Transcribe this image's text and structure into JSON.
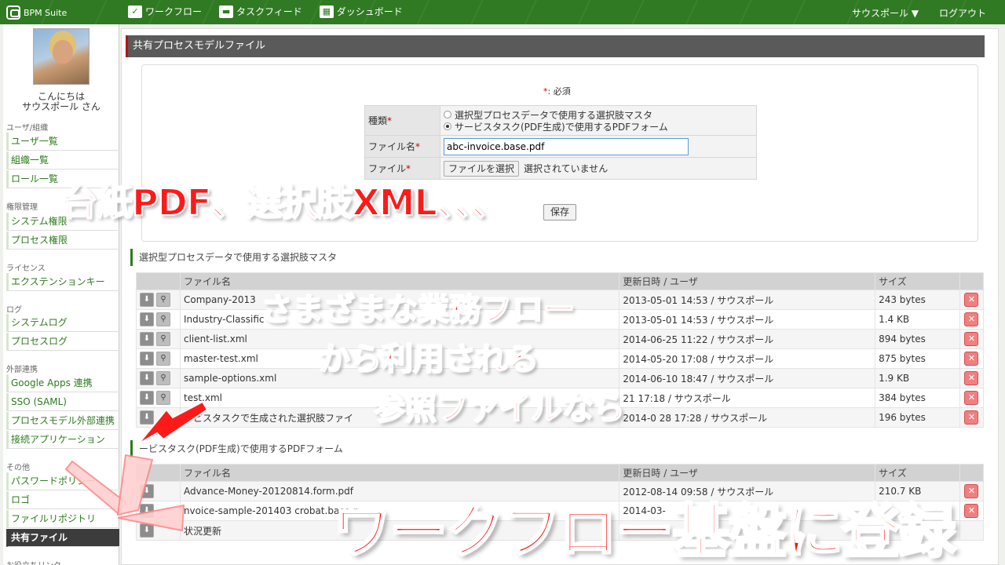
{
  "header": {
    "logo": "BPM Suite",
    "nav": [
      {
        "label": "ワークフロー"
      },
      {
        "label": "タスクフィード"
      },
      {
        "label": "ダッシュボード"
      }
    ],
    "user_menu": "サウスポール ▼",
    "logout": "ログアウト"
  },
  "sidebar": {
    "greeting_line1": "こんにちは",
    "greeting_line2": "サウスポール さん",
    "sections": [
      {
        "title": "ユーザ/組織",
        "items": [
          "ユーザ一覧",
          "組織一覧",
          "ロール一覧"
        ]
      },
      {
        "title": "権限管理",
        "items": [
          "システム権限",
          "プロセス権限"
        ]
      },
      {
        "title": "ライセンス",
        "items": [
          "エクステンションキー"
        ]
      },
      {
        "title": "ログ",
        "items": [
          "システムログ",
          "プロセスログ"
        ]
      },
      {
        "title": "外部連携",
        "items": [
          "Google Apps 連携",
          "SSO (SAML)",
          "プロセスモデル外部連携",
          "接続アプリケーション"
        ]
      },
      {
        "title": "その他",
        "items": [
          "パスワードポリシー",
          "ロゴ",
          "ファイルリポジトリ",
          "共有ファイル"
        ]
      },
      {
        "title": "お役立ちリンク",
        "items": []
      }
    ]
  },
  "panel": {
    "title": "共有プロセスモデルファイル",
    "required_note": ": 必須",
    "required_star": "*",
    "form": {
      "type_label": "種類",
      "type_options": [
        "選択型プロセスデータで使用する選択肢マスタ",
        "サービスタスク(PDF生成)で使用するPDFフォーム"
      ],
      "type_selected_index": 1,
      "filename_label": "ファイル名",
      "filename_value": "abc-invoice.base.pdf",
      "file_label": "ファイル",
      "file_button": "ファイルを選択",
      "file_status": "選択されていません",
      "save_label": "保存"
    }
  },
  "table1": {
    "title": "選択型プロセスデータで使用する選択肢マスタ",
    "headers": [
      "ファイル名",
      "更新日時 / ユーザ",
      "サイズ"
    ],
    "rows": [
      {
        "name": "Company-2013",
        "date": "2013-05-01 14:53 / サウスポール",
        "size": "243 bytes"
      },
      {
        "name": "Industry-Classific",
        "date": "2013-05-01 14:53 / サウスポール",
        "size": "1.4 KB"
      },
      {
        "name": "client-list.xml",
        "date": "2014-06-25 11:22 / サウスポール",
        "size": "894 bytes"
      },
      {
        "name": "master-test.xml",
        "date": "2014-05-20 17:08 / サウスポール",
        "size": "875 bytes"
      },
      {
        "name": "sample-options.xml",
        "date": "2014-06-10 18:47 / サウスポール",
        "size": "1.9 KB"
      },
      {
        "name": "test.xml",
        "date": "21 17:18 / サウスポール",
        "size": "384 bytes"
      },
      {
        "name": "ービスタスクで生成された選択肢ファイ",
        "date": "2014-0 28 17:28 / サウスポール",
        "size": "196 bytes"
      }
    ]
  },
  "table2": {
    "title": "ービスタスク(PDF生成)で使用するPDFフォーム",
    "headers": [
      "ファイル名",
      "更新日時 / ユーザ",
      "サイズ"
    ],
    "rows": [
      {
        "name": "Advance-Money-20120814.form.pdf",
        "date": "2012-08-14 09:58 / サウスポール",
        "size": "210.7 KB"
      },
      {
        "name": "nvoice-sample-201403 crobat.base.p",
        "date": "2014-03-",
        "size": ""
      },
      {
        "name": "状況更新",
        "date": "",
        "size": ""
      }
    ]
  },
  "overlays": {
    "caption1": "台紙PDF、選択肢XML、、、",
    "caption2_line1": "さまざまな業務フロー",
    "caption2_line2": "から利用される",
    "caption2_line3": "参照ファイルなら",
    "caption3": "ワークフロー基盤に登録"
  },
  "colors": {
    "header_green": "#2f7a22",
    "link_green": "#2e7a1e",
    "overlay_red": "#ff1a1a",
    "delete_pink": "#f08080"
  }
}
